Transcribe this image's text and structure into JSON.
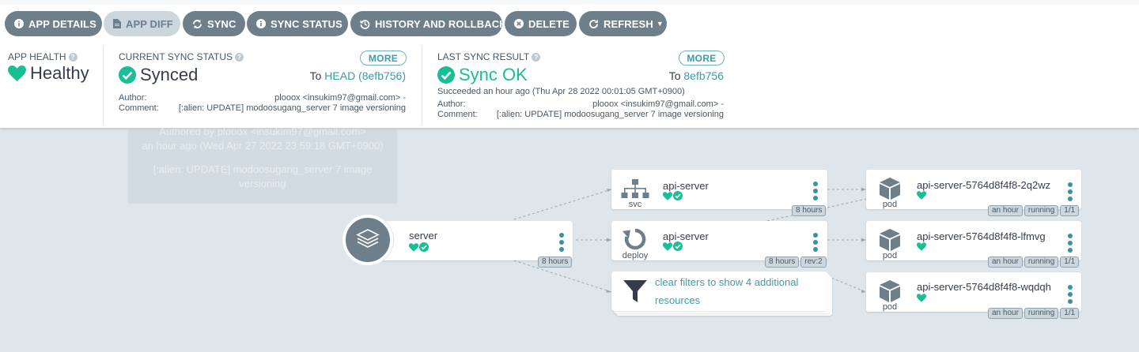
{
  "toolbar": {
    "app_details": "APP DETAILS",
    "app_diff": "APP DIFF",
    "sync": "SYNC",
    "sync_status": "SYNC STATUS",
    "history": "HISTORY AND ROLLBACK",
    "delete": "DELETE",
    "refresh": "REFRESH"
  },
  "health": {
    "title": "APP HEALTH",
    "value": "Healthy"
  },
  "current_sync": {
    "title": "CURRENT SYNC STATUS",
    "value": "Synced",
    "more": "MORE",
    "to_label": "To",
    "to_value": "HEAD (8efb756)",
    "author_label": "Author:",
    "author": "plooox <insukim97@gmail.com> -",
    "comment_label": "Comment:",
    "comment": "[:alien: UPDATE] modoosugang_server 7 image versioning"
  },
  "last_sync": {
    "title": "LAST SYNC RESULT",
    "value": "Sync OK",
    "more": "MORE",
    "to_label": "To",
    "to_value": "8efb756",
    "succeeded": "Succeeded an hour ago (Thu Apr 28 2022 00:01:05 GMT+0900)",
    "author_label": "Author:",
    "author": "plooox <insukim97@gmail.com> -",
    "comment_label": "Comment:",
    "comment": "[:alien: UPDATE] modoosugang_server 7 image versioning"
  },
  "ghost_tooltip": {
    "line1": "Authored by plooox <insukim97@gmail.com>",
    "line2": "an hour ago (Wed Apr 27 2022 23:59:18 GMT+0900)",
    "line3": "[:alien: UPDATE] modoosugang_server 7 image",
    "line4": "versioning"
  },
  "graph": {
    "root": {
      "name": "server",
      "age": "8 hours"
    },
    "svc": {
      "name": "api-server",
      "kind": "svc",
      "age": "8 hours"
    },
    "deploy": {
      "name": "api-server",
      "kind": "deploy",
      "age": "8 hours",
      "rev": "rev:2"
    },
    "filter": {
      "line1": "clear filters to show 4 additional",
      "line2": "resources"
    },
    "pods": [
      {
        "name": "api-server-5764d8f4f8-2q2wz",
        "kind": "pod",
        "age": "an hour",
        "status": "running",
        "ready": "1/1"
      },
      {
        "name": "api-server-5764d8f4f8-lfmvg",
        "kind": "pod",
        "age": "an hour",
        "status": "running",
        "ready": "1/1"
      },
      {
        "name": "api-server-5764d8f4f8-wqdqh",
        "kind": "pod",
        "age": "an hour",
        "status": "running",
        "ready": "1/1"
      }
    ]
  },
  "colors": {
    "healthy": "#18be94",
    "accent": "#3e9aa8",
    "button": "#6d7f8b",
    "background": "#dee6eb"
  }
}
